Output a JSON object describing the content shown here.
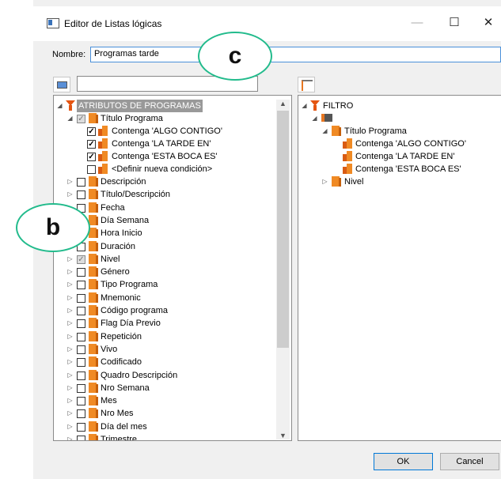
{
  "window": {
    "title": "Editor de Listas lógicas",
    "controls": {
      "minimize": "—",
      "maximize": "☐",
      "close": "✕"
    }
  },
  "name_field": {
    "label": "Nombre:",
    "value": "Programas tarde"
  },
  "left_tree": {
    "root": "ATRIBUTOS DE PROGRAMAS",
    "expanded_item": "Título Programa",
    "conditions": [
      "Contenga 'ALGO CONTIGO'",
      "Contenga 'LA TARDE EN'",
      "Contenga 'ESTA BOCA ES'",
      "<Definir nueva condición>"
    ],
    "attributes": [
      "Descripción",
      "Título/Descripción",
      "Fecha",
      "Día Semana",
      "Hora Inicio",
      "Duración",
      "Nivel",
      "Género",
      "Tipo Programa",
      "Mnemonic",
      "Código programa",
      "Flag Día Previo",
      "Repetición",
      "Vivo",
      "Codificado",
      "Quadro Descripción",
      "Nro Semana",
      "Mes",
      "Nro Mes",
      "Día del mes",
      "Trimestre"
    ]
  },
  "right_tree": {
    "root": "FILTRO",
    "groups": [
      {
        "label": "Título Programa",
        "children": [
          "Contenga 'ALGO CONTIGO'",
          "Contenga 'LA TARDE EN'",
          "Contenga 'ESTA BOCA ES'"
        ]
      },
      {
        "label": "Nivel"
      }
    ]
  },
  "buttons": {
    "ok": "OK",
    "cancel": "Cancel"
  },
  "callouts": {
    "b": "b",
    "c": "c"
  },
  "colors": {
    "accent": "#22bb8c",
    "folder": "#f08a24",
    "selection": "#0078d7"
  }
}
